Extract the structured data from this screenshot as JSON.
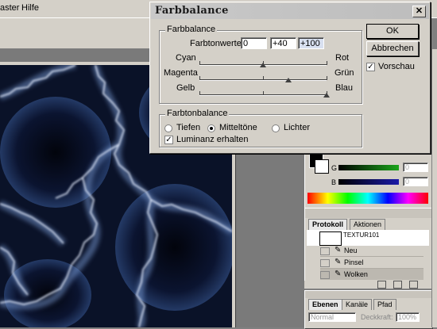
{
  "menubar": {
    "items": [
      "aster",
      "Hilfe"
    ]
  },
  "dialog": {
    "title": "Farbbalance",
    "close_glyph": "✕",
    "balance_group_label": "Farbbalance",
    "values_label": "Farbtonwerte:",
    "values": [
      "0",
      "+40",
      "+100"
    ],
    "sliders": [
      {
        "left": "Cyan",
        "right": "Rot",
        "value": 0
      },
      {
        "left": "Magenta",
        "right": "Grün",
        "value": 40
      },
      {
        "left": "Gelb",
        "right": "Blau",
        "value": 100
      }
    ],
    "tone_group_label": "Farbtonbalance",
    "tones": [
      {
        "label": "Tiefen",
        "selected": false
      },
      {
        "label": "Mitteltöne",
        "selected": true
      },
      {
        "label": "Lichter",
        "selected": false
      }
    ],
    "luminance_label": "Luminanz erhalten",
    "luminance_checked": true,
    "ok_label": "OK",
    "cancel_label": "Abbrechen",
    "preview_label": "Vorschau",
    "preview_checked": true
  },
  "color_panel": {
    "g_label": "G",
    "b_label": "B",
    "g_value": "0",
    "b_value": "0",
    "g_color": "#1ba51b",
    "b_color": "#1a1aa8"
  },
  "history_panel": {
    "tabs": [
      "Protokoll",
      "Aktionen"
    ],
    "snapshot_label": "TEXTUR101",
    "steps": [
      "Neu",
      "Pinsel",
      "Wolken"
    ]
  },
  "layers_panel": {
    "tabs": [
      "Ebenen",
      "Kanäle",
      "Pfad"
    ],
    "blend_mode": "Normal",
    "opacity_label": "Deckkraft:",
    "opacity_value": "100%"
  },
  "colors": {
    "dialog_bg": "#d4d0c8",
    "canvas_dark": "#060a18",
    "lightning": "#dfe8ff"
  }
}
